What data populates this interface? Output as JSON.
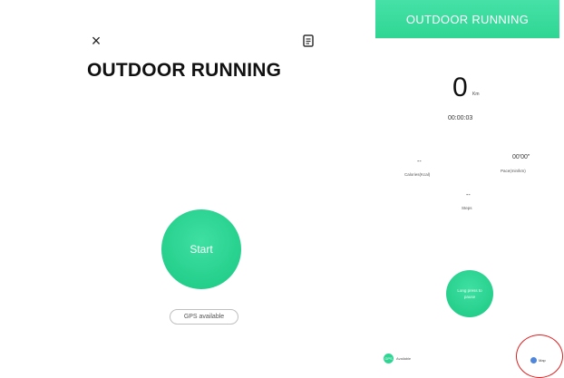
{
  "left": {
    "close_icon": "×",
    "title": "OUTDOOR RUNNING",
    "start_label": "Start",
    "gps_label": "GPS available"
  },
  "right": {
    "banner_title": "OUTDOOR RUNNING",
    "distance_value": "0",
    "distance_unit": "Km",
    "elapsed_time": "00:00:03",
    "calories_value": "--",
    "calories_label": "Calories(Kcal)",
    "pace_value": "00'00\"",
    "pace_label": "Pace(min/km)",
    "steps_value": "--",
    "steps_label": "Steps",
    "start_line1": "Long press to",
    "start_line2": "pause",
    "gps_icon_text": "GPS",
    "gps_label": "Available",
    "map_label": "Map"
  },
  "colors": {
    "accent": "#2fd693",
    "highlight": "#e02020"
  },
  "icons": [
    "close-icon",
    "history-icon",
    "gps-icon",
    "map-icon"
  ]
}
